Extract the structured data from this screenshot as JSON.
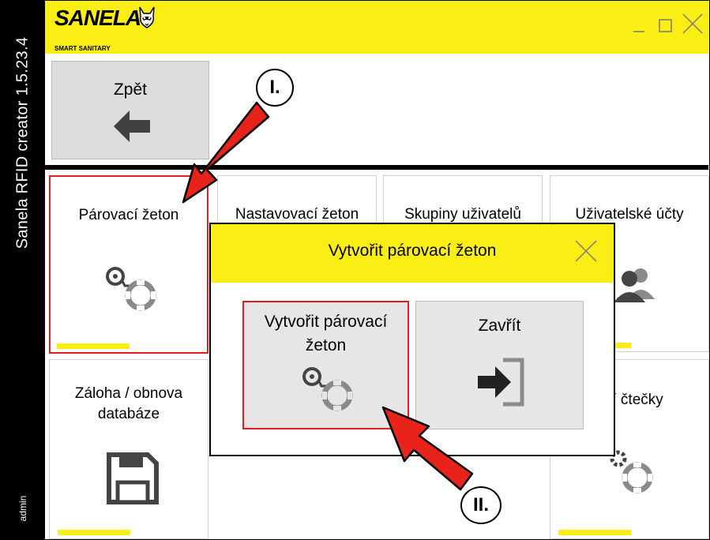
{
  "app": {
    "vertical_title": "Sanela RFID creator 1.5.23.4",
    "user": "admin"
  },
  "header": {
    "logo_text": "SANELA",
    "logo_subtitle": "SMART SANITARY",
    "logo_icon": "raccoon-mascot-icon"
  },
  "window_controls": [
    "minimize-icon",
    "maximize-icon",
    "close-icon"
  ],
  "back_button": {
    "label": "Zpět",
    "icon": "arrow-left-icon"
  },
  "tiles": [
    {
      "label": "Párovací žeton",
      "icon": "pairing-token-icon",
      "selected": true
    },
    {
      "label": "Nastavovací žeton",
      "icon": "settings-token-icon"
    },
    {
      "label": "Skupiny uživatelů",
      "icon": "user-groups-icon"
    },
    {
      "label": "Uživatelské účty",
      "icon": "users-icon"
    },
    {
      "label": "Záloha / obnova\ndatabáze",
      "icon": "save-disk-icon"
    },
    {
      "label": "ení čtečky",
      "icon": "reader-settings-icon"
    }
  ],
  "dialog": {
    "title": "Vytvořit párovací žeton",
    "create_button": "Vytvořit párovací\nžeton",
    "close_button": "Zavřít"
  },
  "annotations": {
    "step1": "I.",
    "step2": "II."
  },
  "colors": {
    "accent_yellow": "#fbee14",
    "highlight_red": "#e02020",
    "icon_gray": "#8a8a8a",
    "arrow_red": "#e8231c"
  }
}
